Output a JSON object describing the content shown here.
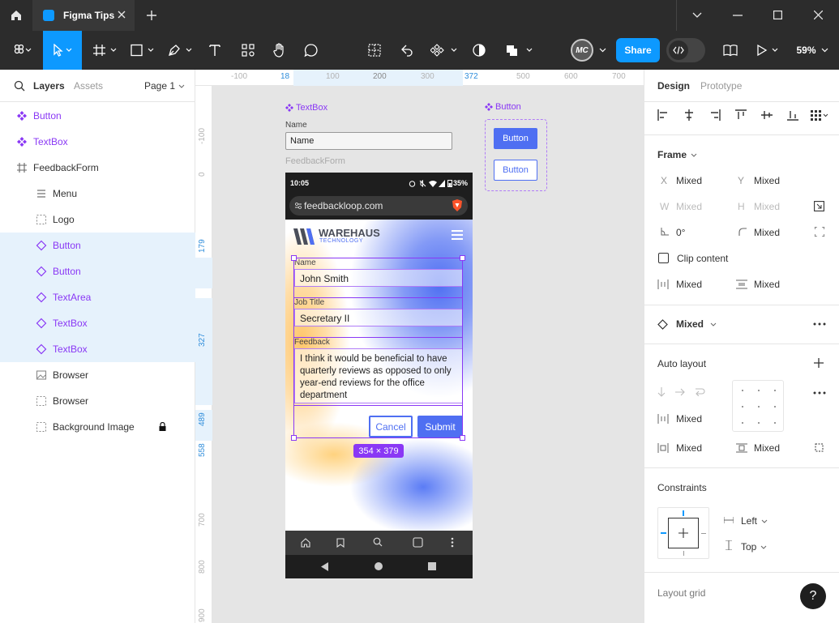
{
  "window": {
    "tab_title": "Figma Tips"
  },
  "toolbar": {
    "share_label": "Share",
    "zoom": "59%",
    "avatar_initials": "MC"
  },
  "left_panel": {
    "tabs": {
      "layers": "Layers",
      "assets": "Assets"
    },
    "page": "Page 1",
    "layers": [
      {
        "label": "Button",
        "kind": "component"
      },
      {
        "label": "TextBox",
        "kind": "component"
      },
      {
        "label": "FeedbackForm",
        "kind": "frame"
      },
      {
        "label": "Menu",
        "kind": "menu"
      },
      {
        "label": "Logo",
        "kind": "frame-dashed"
      },
      {
        "label": "Button",
        "kind": "instance"
      },
      {
        "label": "Button",
        "kind": "instance"
      },
      {
        "label": "TextArea",
        "kind": "instance"
      },
      {
        "label": "TextBox",
        "kind": "instance"
      },
      {
        "label": "TextBox",
        "kind": "instance"
      },
      {
        "label": "Browser",
        "kind": "image"
      },
      {
        "label": "Browser",
        "kind": "frame-dashed"
      },
      {
        "label": "Background Image",
        "kind": "frame-dashed"
      }
    ]
  },
  "rulers": {
    "top": [
      "-100",
      "18",
      "100",
      "200",
      "300",
      "372",
      "500",
      "600",
      "700"
    ],
    "left": [
      "-100",
      "0",
      "179",
      "327",
      "489",
      "558",
      "700",
      "800",
      "900"
    ]
  },
  "canvas": {
    "textbox_component": {
      "title": "TextBox",
      "label": "Name",
      "value": "Name"
    },
    "button_component": {
      "title": "Button",
      "primary": "Button",
      "secondary": "Button"
    },
    "frame_label": "FeedbackForm",
    "phone": {
      "time": "10:05",
      "battery": "35%",
      "url": "feedbackloop.com",
      "brand": "WAREHAUS",
      "brand_sub": "TECHNOLOGY",
      "name_label": "Name",
      "name_value": "John Smith",
      "job_label": "Job Title",
      "job_value": "Secretary II",
      "feedback_label": "Feedback",
      "feedback_value": "I think it would be beneficial to have quarterly reviews as opposed to only year-end reviews for the office department",
      "cancel": "Cancel",
      "submit": "Submit"
    },
    "selection_size": "354 × 379"
  },
  "right_panel": {
    "tabs": {
      "design": "Design",
      "prototype": "Prototype"
    },
    "frame": {
      "title": "Frame",
      "x_label": "X",
      "x": "Mixed",
      "y_label": "Y",
      "y": "Mixed",
      "w_label": "W",
      "w": "Mixed",
      "h_label": "H",
      "h": "Mixed",
      "rotation": "0°",
      "radius": "Mixed",
      "clip": "Clip content",
      "gap_h": "Mixed",
      "gap_v": "Mixed"
    },
    "instance": {
      "value": "Mixed"
    },
    "auto_layout": {
      "title": "Auto layout",
      "spacing": "Mixed",
      "pad_h": "Mixed",
      "pad_v": "Mixed"
    },
    "constraints": {
      "title": "Constraints",
      "horizontal": "Left",
      "vertical": "Top"
    },
    "layout_grid": {
      "title": "Layout grid"
    },
    "help": "?"
  },
  "colors": {
    "accent": "#0d99ff",
    "purple": "#8a38f5",
    "brand_blue": "#4f6ff2",
    "chrome": "#2c2c2c"
  }
}
